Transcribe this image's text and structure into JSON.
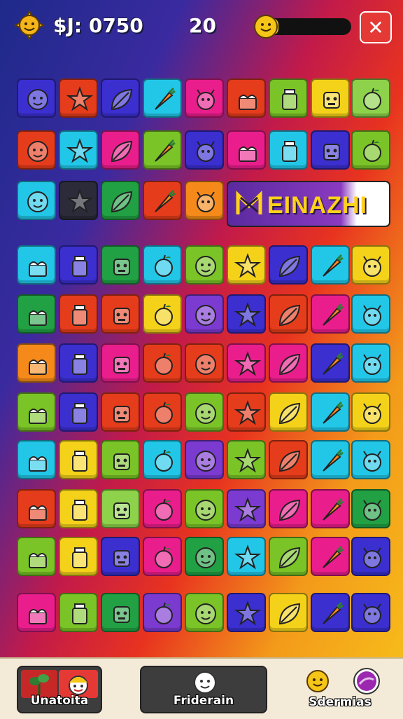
{
  "header": {
    "coins_label": "$J: 0750",
    "moves_label": "20",
    "energy_fraction": 0.15,
    "close_label": "✕"
  },
  "banner": {
    "text": "EINAZHI",
    "icon": "m-logo-icon"
  },
  "board": {
    "rows_top": [
      [
        "#3b2fd0",
        "#e53c1c",
        "#3b2fd0",
        "#22c7e8",
        "#e91e8c",
        "#e53c1c",
        "#7ac427",
        "#f5d21a",
        "#8dd24a"
      ],
      [
        "#e53c1c",
        "#22c7e8",
        "#e91e8c",
        "#7ac427",
        "#3b2fd0",
        "#e91e8c",
        "#22c7e8",
        "#3b2fd0",
        "#7ac427"
      ],
      [
        "#22c7e8",
        "#2b2b3a",
        "#22a044",
        "#e53c1c",
        "#f58a1a"
      ]
    ],
    "rows_bottom": [
      [
        "#22c7e8",
        "#3b2fd0",
        "#22a044",
        "#22c7e8",
        "#7ac427",
        "#f5d21a",
        "#3b2fd0",
        "#22c7e8",
        "#f5d21a"
      ],
      [
        "#22a044",
        "#e53c1c",
        "#e53c1c",
        "#f5d21a",
        "#7b3ad0",
        "#3b2fd0",
        "#e53c1c",
        "#e91e8c",
        "#22c7e8"
      ],
      [
        "#f58a1a",
        "#3b2fd0",
        "#e91e8c",
        "#e53c1c",
        "#e53c1c",
        "#e91e8c",
        "#e91e8c",
        "#3b2fd0",
        "#22c7e8"
      ],
      [
        "#7ac427",
        "#3b2fd0",
        "#e53c1c",
        "#e53c1c",
        "#7ac427",
        "#e53c1c",
        "#f5d21a",
        "#22c7e8",
        "#f5d21a"
      ],
      [
        "#22c7e8",
        "#f5d21a",
        "#7ac427",
        "#22c7e8",
        "#7b3ad0",
        "#7ac427",
        "#e53c1c",
        "#22c7e8",
        "#22c7e8"
      ],
      [
        "#e53c1c",
        "#f5d21a",
        "#8dd24a",
        "#e91e8c",
        "#7ac427",
        "#7b3ad0",
        "#e91e8c",
        "#e91e8c",
        "#22a044"
      ],
      [
        "#7ac427",
        "#f5d21a",
        "#3b2fd0",
        "#e91e8c",
        "#22a044",
        "#22c7e8",
        "#7ac427",
        "#e91e8c",
        "#3b2fd0"
      ],
      [
        "#e91e8c",
        "#7ac427",
        "#22a044",
        "#7b3ad0",
        "#7ac427",
        "#3b2fd0",
        "#f5d21a",
        "#3b2fd0",
        "#3b2fd0"
      ]
    ],
    "icons": [
      "face",
      "star",
      "leaf",
      "carrot",
      "bug",
      "cake",
      "jar",
      "robot",
      "apple"
    ]
  },
  "bottom_bar": {
    "left_label": "Unatoita",
    "center_label": "Friderain",
    "right_label": "Sdermias"
  }
}
